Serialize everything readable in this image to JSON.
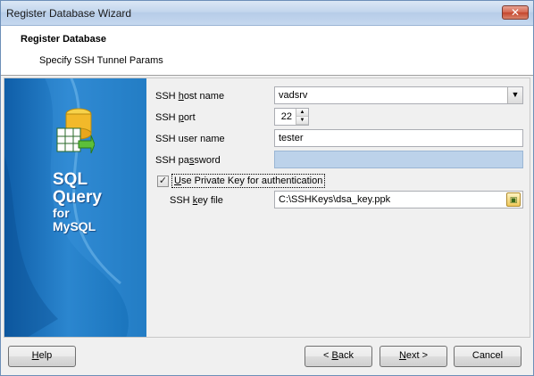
{
  "window": {
    "title": "Register Database Wizard",
    "close_glyph": "✕"
  },
  "header": {
    "title": "Register Database",
    "subtitle": "Specify SSH Tunnel Params"
  },
  "banner": {
    "product_line1": "SQL",
    "product_line2": "Query",
    "product_line3": "for",
    "product_line4": "MySQL",
    "logo_icon": "database-table-icon"
  },
  "form": {
    "host_label_pre": "SSH ",
    "host_label_accel": "h",
    "host_label_post": "ost name",
    "host_value": "vadsrv",
    "port_label_pre": "SSH ",
    "port_label_accel": "p",
    "port_label_post": "ort",
    "port_value": "22",
    "user_label": "SSH user name",
    "user_value": "tester",
    "password_label_pre": "SSH pa",
    "password_label_accel": "s",
    "password_label_post": "sword",
    "password_value": "",
    "use_key_label_pre": "",
    "use_key_label_accel": "U",
    "use_key_label_post": "se Private Key for authentication",
    "use_key_checked": true,
    "keyfile_label_pre": "SSH ",
    "keyfile_label_accel": "k",
    "keyfile_label_post": "ey file",
    "keyfile_value": "C:\\SSHKeys\\dsa_key.ppk"
  },
  "footer": {
    "help_accel": "H",
    "help_rest": "elp",
    "back_pre": "< ",
    "back_accel": "B",
    "back_rest": "ack",
    "next_accel": "N",
    "next_rest": "ext >",
    "cancel_label": "Cancel"
  },
  "colors": {
    "banner": "#1670b8",
    "disabled_field": "#bcd2ea"
  }
}
